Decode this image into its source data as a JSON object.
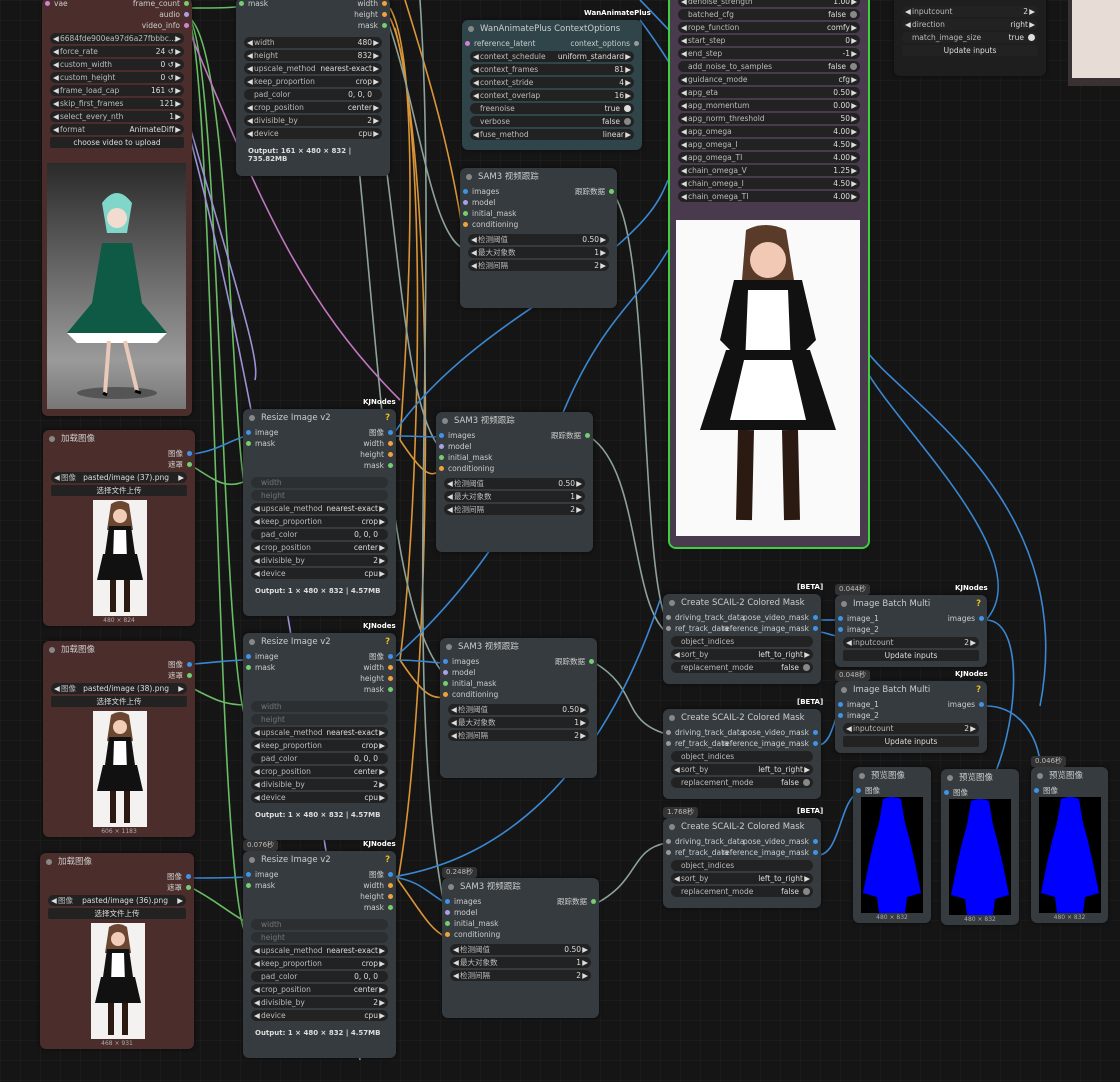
{
  "colors": {
    "image": "#3f94e8",
    "mask": "#74cf6e",
    "int": "#f0a33a",
    "latent": "#d282d2",
    "node_bg": "#353b3f",
    "selected": "#3ecf3e",
    "mask_blue": "#0000ff"
  },
  "video_node": {
    "io": [
      {
        "in": "vae",
        "out": "frame_count"
      },
      {
        "in": "",
        "out": "audio"
      },
      {
        "in": "",
        "out": "video_info"
      }
    ],
    "widgets": [
      {
        "label": "6684fde900ea97d6a27fbbbc...",
        "value": ""
      },
      {
        "label": "force_rate",
        "value": "24 ↺"
      },
      {
        "label": "custom_width",
        "value": "0 ↺"
      },
      {
        "label": "custom_height",
        "value": "0 ↺"
      },
      {
        "label": "frame_load_cap",
        "value": "161 ↺"
      },
      {
        "label": "skip_first_frames",
        "value": "121"
      },
      {
        "label": "select_every_nth",
        "value": "1"
      },
      {
        "label": "format",
        "value": "AnimateDiff"
      }
    ],
    "button": "choose video to upload"
  },
  "resize_top": {
    "io": [
      {
        "in": "mask",
        "out": "width"
      },
      {
        "in": "",
        "out": "height"
      },
      {
        "in": "",
        "out": "mask"
      }
    ],
    "widgets": [
      {
        "label": "width",
        "value": "480"
      },
      {
        "label": "height",
        "value": "832"
      },
      {
        "label": "upscale_method",
        "value": "nearest-exact"
      },
      {
        "label": "keep_proportion",
        "value": "crop"
      },
      {
        "label": "pad_color",
        "value": "0, 0, 0"
      },
      {
        "label": "crop_position",
        "value": "center"
      },
      {
        "label": "divisible_by",
        "value": "2"
      },
      {
        "label": "device",
        "value": "cpu"
      }
    ],
    "output": "Output: 161 × 480 × 832 | 735.82MB"
  },
  "context": {
    "tag": "WanAnimatePlus",
    "title": "WanAnimatePlus ContextOptions",
    "io_in": "reference_latent",
    "io_out": "context_options",
    "widgets": [
      {
        "label": "context_schedule",
        "value": "uniform_standard"
      },
      {
        "label": "context_frames",
        "value": "81"
      },
      {
        "label": "context_stride",
        "value": "4"
      },
      {
        "label": "context_overlap",
        "value": "16"
      },
      {
        "label": "freenoise",
        "value": "true"
      },
      {
        "label": "verbose",
        "value": "false"
      },
      {
        "label": "fuse_method",
        "value": "linear"
      }
    ]
  },
  "sampler": {
    "widgets": [
      {
        "label": "denoise_strength",
        "value": "1.00"
      },
      {
        "label": "batched_cfg",
        "value": "false"
      },
      {
        "label": "rope_function",
        "value": "comfy"
      },
      {
        "label": "start_step",
        "value": "0"
      },
      {
        "label": "end_step",
        "value": "-1"
      },
      {
        "label": "add_noise_to_samples",
        "value": "false"
      },
      {
        "label": "guidance_mode",
        "value": "cfg"
      },
      {
        "label": "apg_eta",
        "value": "0.50"
      },
      {
        "label": "apg_momentum",
        "value": "0.00"
      },
      {
        "label": "apg_norm_threshold",
        "value": "50"
      },
      {
        "label": "apg_omega",
        "value": "4.00"
      },
      {
        "label": "apg_omega_I",
        "value": "4.50"
      },
      {
        "label": "apg_omega_TI",
        "value": "4.00"
      },
      {
        "label": "chain_omega_V",
        "value": "1.25"
      },
      {
        "label": "chain_omega_I",
        "value": "4.50"
      },
      {
        "label": "chain_omega_TI",
        "value": "4.00"
      }
    ]
  },
  "inputs_node": {
    "widgets": [
      {
        "label": "inputcount",
        "value": "2"
      },
      {
        "label": "direction",
        "value": "right"
      },
      {
        "label": "match_image_size",
        "value": "true"
      }
    ],
    "button": "Update inputs"
  },
  "sam_nodes": [
    {
      "title": "SAM3 视频跟踪",
      "io": [
        {
          "in": "images",
          "out": "跟踪数据"
        },
        {
          "in": "model",
          "out": ""
        },
        {
          "in": "initial_mask",
          "out": ""
        },
        {
          "in": "conditioning",
          "out": ""
        }
      ],
      "widgets": [
        {
          "label": "检测阈值",
          "value": "0.50"
        },
        {
          "label": "最大对象数",
          "value": "1"
        },
        {
          "label": "检测间隔",
          "value": "2"
        }
      ]
    },
    {
      "title": "SAM3 视频跟踪",
      "io": [
        {
          "in": "images",
          "out": "跟踪数据"
        },
        {
          "in": "model",
          "out": ""
        },
        {
          "in": "initial_mask",
          "out": ""
        },
        {
          "in": "conditioning",
          "out": ""
        }
      ],
      "widgets": [
        {
          "label": "检测阈值",
          "value": "0.50"
        },
        {
          "label": "最大对象数",
          "value": "1"
        },
        {
          "label": "检测间隔",
          "value": "2"
        }
      ]
    },
    {
      "title": "SAM3 视频跟踪",
      "io": [
        {
          "in": "images",
          "out": "跟踪数据"
        },
        {
          "in": "model",
          "out": ""
        },
        {
          "in": "initial_mask",
          "out": ""
        },
        {
          "in": "conditioning",
          "out": ""
        }
      ],
      "widgets": [
        {
          "label": "检测阈值",
          "value": "0.50"
        },
        {
          "label": "最大对象数",
          "value": "1"
        },
        {
          "label": "检测间隔",
          "value": "2"
        }
      ]
    },
    {
      "title": "SAM3 视频跟踪",
      "timer": "0.248秒",
      "io": [
        {
          "in": "images",
          "out": "跟踪数据"
        },
        {
          "in": "model",
          "out": ""
        },
        {
          "in": "initial_mask",
          "out": ""
        },
        {
          "in": "conditioning",
          "out": ""
        }
      ],
      "widgets": [
        {
          "label": "检测阈值",
          "value": "0.50"
        },
        {
          "label": "最大对象数",
          "value": "1"
        },
        {
          "label": "检测间隔",
          "value": "2"
        }
      ]
    }
  ],
  "resize_nodes": [
    {
      "tag": "KJNodes",
      "title": "Resize Image v2",
      "io": [
        {
          "in": "image",
          "out": "图像"
        },
        {
          "in": "mask",
          "out": "width"
        },
        {
          "in": "",
          "out": "height"
        },
        {
          "in": "",
          "out": "mask"
        }
      ],
      "disabled": [
        "width",
        "height"
      ],
      "widgets": [
        {
          "label": "upscale_method",
          "value": "nearest-exact"
        },
        {
          "label": "keep_proportion",
          "value": "crop"
        },
        {
          "label": "pad_color",
          "value": "0, 0, 0"
        },
        {
          "label": "crop_position",
          "value": "center"
        },
        {
          "label": "divisible_by",
          "value": "2"
        },
        {
          "label": "device",
          "value": "cpu"
        }
      ],
      "output": "Output: 1 × 480 × 832 | 4.57MB"
    },
    {
      "tag": "KJNodes",
      "title": "Resize Image v2",
      "io": [
        {
          "in": "image",
          "out": "图像"
        },
        {
          "in": "mask",
          "out": "width"
        },
        {
          "in": "",
          "out": "height"
        },
        {
          "in": "",
          "out": "mask"
        }
      ],
      "disabled": [
        "width",
        "height"
      ],
      "widgets": [
        {
          "label": "upscale_method",
          "value": "nearest-exact"
        },
        {
          "label": "keep_proportion",
          "value": "crop"
        },
        {
          "label": "pad_color",
          "value": "0, 0, 0"
        },
        {
          "label": "crop_position",
          "value": "center"
        },
        {
          "label": "divisible_by",
          "value": "2"
        },
        {
          "label": "device",
          "value": "cpu"
        }
      ],
      "output": "Output: 1 × 480 × 832 | 4.57MB"
    },
    {
      "tag": "KJNodes",
      "timer": "0.076秒",
      "title": "Resize Image v2",
      "io": [
        {
          "in": "image",
          "out": "图像"
        },
        {
          "in": "mask",
          "out": "width"
        },
        {
          "in": "",
          "out": "height"
        },
        {
          "in": "",
          "out": "mask"
        }
      ],
      "disabled": [
        "width",
        "height"
      ],
      "widgets": [
        {
          "label": "upscale_method",
          "value": "nearest-exact"
        },
        {
          "label": "keep_proportion",
          "value": "crop"
        },
        {
          "label": "pad_color",
          "value": "0, 0, 0"
        },
        {
          "label": "crop_position",
          "value": "center"
        },
        {
          "label": "divisible_by",
          "value": "2"
        },
        {
          "label": "device",
          "value": "cpu"
        }
      ],
      "output": "Output: 1 × 480 × 832 | 4.57MB"
    }
  ],
  "load_nodes": [
    {
      "title": "加载图像",
      "out1": "图像",
      "out2": "遮罩",
      "widget_label": "图像",
      "widget_value": "pasted/image (37).png",
      "button": "选择文件上传",
      "dims": "480 × 824"
    },
    {
      "title": "加载图像",
      "out1": "图像",
      "out2": "遮罩",
      "widget_label": "图像",
      "widget_value": "pasted/image (38).png",
      "button": "选择文件上传",
      "dims": "606 × 1183"
    },
    {
      "title": "加载图像",
      "out1": "图像",
      "out2": "遮罩",
      "widget_label": "图像",
      "widget_value": "pasted/image (36).png",
      "button": "选择文件上传",
      "dims": "468 × 931"
    }
  ],
  "scail_nodes": [
    {
      "tag": "[BETA]",
      "title": "Create SCAIL-2 Colored Mask",
      "io": [
        {
          "in": "driving_track_data",
          "out": "pose_video_mask"
        },
        {
          "in": "ref_track_data",
          "out": "reference_image_mask"
        }
      ],
      "widgets": [
        {
          "label": "object_indices",
          "value": ""
        },
        {
          "label": "sort_by",
          "value": "left_to_right"
        },
        {
          "label": "replacement_mode",
          "value": "false"
        }
      ]
    },
    {
      "tag": "[BETA]",
      "title": "Create SCAIL-2 Colored Mask",
      "io": [
        {
          "in": "driving_track_data",
          "out": "pose_video_mask"
        },
        {
          "in": "ref_track_data",
          "out": "reference_image_mask"
        }
      ],
      "widgets": [
        {
          "label": "object_indices",
          "value": ""
        },
        {
          "label": "sort_by",
          "value": "left_to_right"
        },
        {
          "label": "replacement_mode",
          "value": "false"
        }
      ]
    },
    {
      "tag": "[BETA]",
      "timer": "1.768秒",
      "title": "Create SCAIL-2 Colored Mask",
      "io": [
        {
          "in": "driving_track_data",
          "out": "pose_video_mask"
        },
        {
          "in": "ref_track_data",
          "out": "reference_image_mask"
        }
      ],
      "widgets": [
        {
          "label": "object_indices",
          "value": ""
        },
        {
          "label": "sort_by",
          "value": "left_to_right"
        },
        {
          "label": "replacement_mode",
          "value": "false"
        }
      ]
    }
  ],
  "batch_nodes": [
    {
      "tag": "KJNodes",
      "timer": "0.044秒",
      "title": "Image Batch Multi",
      "in1": "image_1",
      "in2": "image_2",
      "out": "images",
      "widget_label": "inputcount",
      "widget_value": "2",
      "button": "Update inputs"
    },
    {
      "tag": "KJNodes",
      "timer": "0.048秒",
      "title": "Image Batch Multi",
      "in1": "image_1",
      "in2": "image_2",
      "out": "images",
      "widget_label": "inputcount",
      "widget_value": "2",
      "button": "Update inputs"
    }
  ],
  "preview_nodes": [
    {
      "title": "预览图像",
      "in": "图像",
      "dims": "480 × 832"
    },
    {
      "title": "预览图像",
      "in": "图像",
      "dims": "480 × 832"
    },
    {
      "title": "预览图像",
      "timer": "0.046秒",
      "in": "图像",
      "dims": "480 × 832"
    }
  ]
}
